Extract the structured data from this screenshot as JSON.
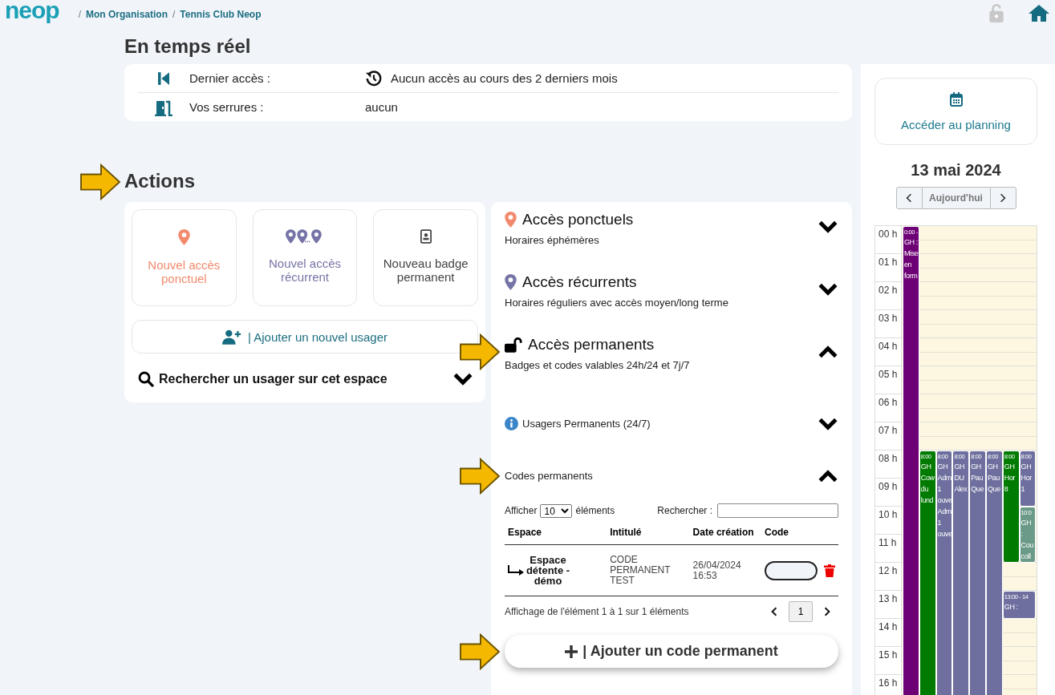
{
  "header": {
    "logo": "neop",
    "breadcrumb": [
      {
        "sep": "/",
        "label": "Mon Organisation"
      },
      {
        "sep": "/",
        "label": "Tennis Club Neop"
      }
    ]
  },
  "realtime": {
    "title": "En temps réel",
    "rows": [
      {
        "kind": "last_access",
        "label": "Dernier accès :",
        "value": "Aucun accès au cours des 2 derniers mois"
      },
      {
        "kind": "locks",
        "label": "Vos serrures :",
        "value": "aucun"
      }
    ]
  },
  "actions": {
    "title": "Actions",
    "marked": true,
    "tiles": [
      {
        "kind": "ponctuel",
        "label": "Nouvel accès ponctuel"
      },
      {
        "kind": "recurrent",
        "label": "Nouvel accès récurrent"
      },
      {
        "kind": "badge",
        "label": "Nouveau badge permanent"
      }
    ],
    "add_user": "| Ajouter un nouvel usager",
    "search_user": {
      "label": "Rechercher un usager sur cet espace",
      "expanded": false
    }
  },
  "access_sections": [
    {
      "kind": "ponctuel",
      "title": "Accès ponctuels",
      "subtitle": "Horaires éphémères",
      "expanded": false,
      "marked": false
    },
    {
      "kind": "recurrent",
      "title": "Accès récurrents",
      "subtitle": "Horaires réguliers avec accès moyen/long terme",
      "expanded": false,
      "marked": false
    },
    {
      "kind": "permanent",
      "title": "Accès permanents",
      "subtitle": "Badges et codes valables 24h/24 et 7j/7",
      "expanded": true,
      "marked": true,
      "subsections": [
        {
          "kind": "info",
          "title": "Usagers Permanents (24/7)",
          "expanded": false,
          "marked": false
        },
        {
          "kind": "plain",
          "title": "Codes permanents",
          "expanded": true,
          "marked": true,
          "table": {
            "show_label": "Afficher",
            "show_value": "10",
            "show_suffix": "éléments",
            "search_label": "Rechercher :",
            "columns": [
              "Espace",
              "Intitulé",
              "Date création",
              "Code"
            ],
            "rows": [
              {
                "espace": "Espace détente - démo",
                "intitule": "CODE PERMANENT TEST",
                "date": "26/04/2024 16:53"
              }
            ],
            "info": "Affichage de l'élément 1 à 1 sur 1 éléments",
            "pages": [
              {
                "label": "1",
                "selected": true
              }
            ]
          }
        }
      ]
    }
  ],
  "add_code": {
    "label": "| Ajouter un code permanent",
    "marked": true
  },
  "sidebar": {
    "planning": "Accéder au planning",
    "date": "13 mai 2024",
    "today": "Aujourd'hui",
    "hours": [
      {
        "label": "00 h",
        "events": [
          {
            "time": "0:00 -",
            "lines": [
              "GH :",
              "Mise",
              "en",
              "form"
            ],
            "color": "#6e0075",
            "slots": [
              true,
              true,
              true,
              true,
              true,
              true,
              true,
              true,
              true,
              true,
              true,
              true,
              true,
              true,
              true,
              true,
              true
            ]
          }
        ]
      },
      {
        "label": "01 h"
      },
      {
        "label": "02 h"
      },
      {
        "label": "03 h"
      },
      {
        "label": "04 h"
      },
      {
        "label": "05 h"
      },
      {
        "label": "06 h"
      },
      {
        "label": "07 h"
      },
      {
        "label": "08 h",
        "events": [
          {
            "time": "8:00",
            "lines": [
              "GH",
              "Cow",
              "du",
              "lund"
            ],
            "color": "#007a00",
            "slots": [
              true,
              true,
              true,
              true,
              true,
              true,
              true,
              true,
              true
            ]
          },
          {
            "time": "8:00",
            "lines": [
              "GH",
              "Adm",
              "1",
              "ouve",
              "Adm",
              "1",
              "ouve"
            ],
            "color": "#6e6f9e",
            "slots": [
              true,
              true,
              true,
              true,
              true,
              true,
              true,
              true,
              true
            ]
          },
          {
            "time": "8:00",
            "lines": [
              "GH",
              "DU",
              "Alex"
            ],
            "color": "#6e6f9e",
            "slots": [
              true,
              true,
              true,
              true,
              true,
              true,
              true,
              true,
              true
            ]
          },
          {
            "time": "8:00",
            "lines": [
              "GH",
              "Pau",
              "Que"
            ],
            "color": "#6e6f9e",
            "slots": [
              true,
              true,
              true,
              true,
              true,
              true,
              true,
              true,
              true
            ]
          },
          {
            "time": "8:00",
            "lines": [
              "GH",
              "Pau",
              "Que"
            ],
            "color": "#6e6f9e",
            "slots": [
              true,
              true,
              true,
              true,
              true,
              true,
              true,
              true,
              true
            ]
          },
          {
            "time": "8:00",
            "lines": [
              "GH",
              "Hor",
              "8"
            ],
            "color": "#007a00",
            "slots": [
              true,
              true,
              true,
              true
            ]
          },
          {
            "time": "8:00",
            "lines": [
              "GH",
              "Hor",
              "1"
            ],
            "color": "#6e6f9e",
            "slots": [
              true,
              true
            ]
          }
        ]
      },
      {
        "label": "09 h"
      },
      {
        "label": "10 h",
        "events": [
          {
            "time": "10:0",
            "lines": [
              "GH",
              ":",
              "Cou",
              "coll"
            ],
            "color": "#6b9a88",
            "slots": [
              true,
              true
            ]
          }
        ]
      },
      {
        "label": "11 h"
      },
      {
        "label": "12 h"
      },
      {
        "label": "13 h",
        "events": [
          {
            "time": "13:00 - 14",
            "lines": [
              "GH :"
            ],
            "color": "#6e6f9e",
            "slots": [
              true
            ]
          }
        ]
      },
      {
        "label": "14 h"
      },
      {
        "label": "15 h"
      },
      {
        "label": "16 h"
      }
    ]
  }
}
